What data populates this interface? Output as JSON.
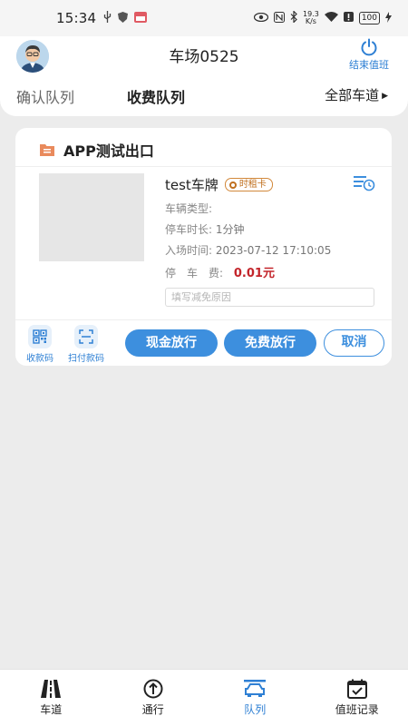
{
  "status_bar": {
    "time": "15:34",
    "network_speed": "19.3\nK/s",
    "battery": "100"
  },
  "header": {
    "title": "车场0525",
    "end_shift_label": "结束值班"
  },
  "tabs": [
    {
      "label": "确认队列"
    },
    {
      "label": "收费队列"
    },
    {
      "label": "全部车道"
    }
  ],
  "card": {
    "exit_name": "APP测试出口",
    "plate": "test车牌",
    "badge": "时租卡",
    "vehicle_type_label": "车辆类型:",
    "vehicle_type_value": "",
    "duration_label": "停车时长:",
    "duration_value": "1分钟",
    "entry_label": "入场时间:",
    "entry_value": "2023-07-12 17:10:05",
    "fee_label": "停　车　费:",
    "fee_value": "0.01元",
    "reason_placeholder": "填写减免原因",
    "qrcode_label": "收款码",
    "scan_label": "扫付款码",
    "cash_button": "现金放行",
    "free_button": "免费放行",
    "cancel_button": "取消"
  },
  "bottom_nav": [
    {
      "label": "车道",
      "icon": "lane-icon"
    },
    {
      "label": "通行",
      "icon": "pass-icon"
    },
    {
      "label": "队列",
      "icon": "queue-icon",
      "active": true
    },
    {
      "label": "值班记录",
      "icon": "calendar-check-icon"
    }
  ],
  "colors": {
    "accent": "#3d8fde",
    "fee": "#c3242a",
    "badge": "#c0701f"
  }
}
